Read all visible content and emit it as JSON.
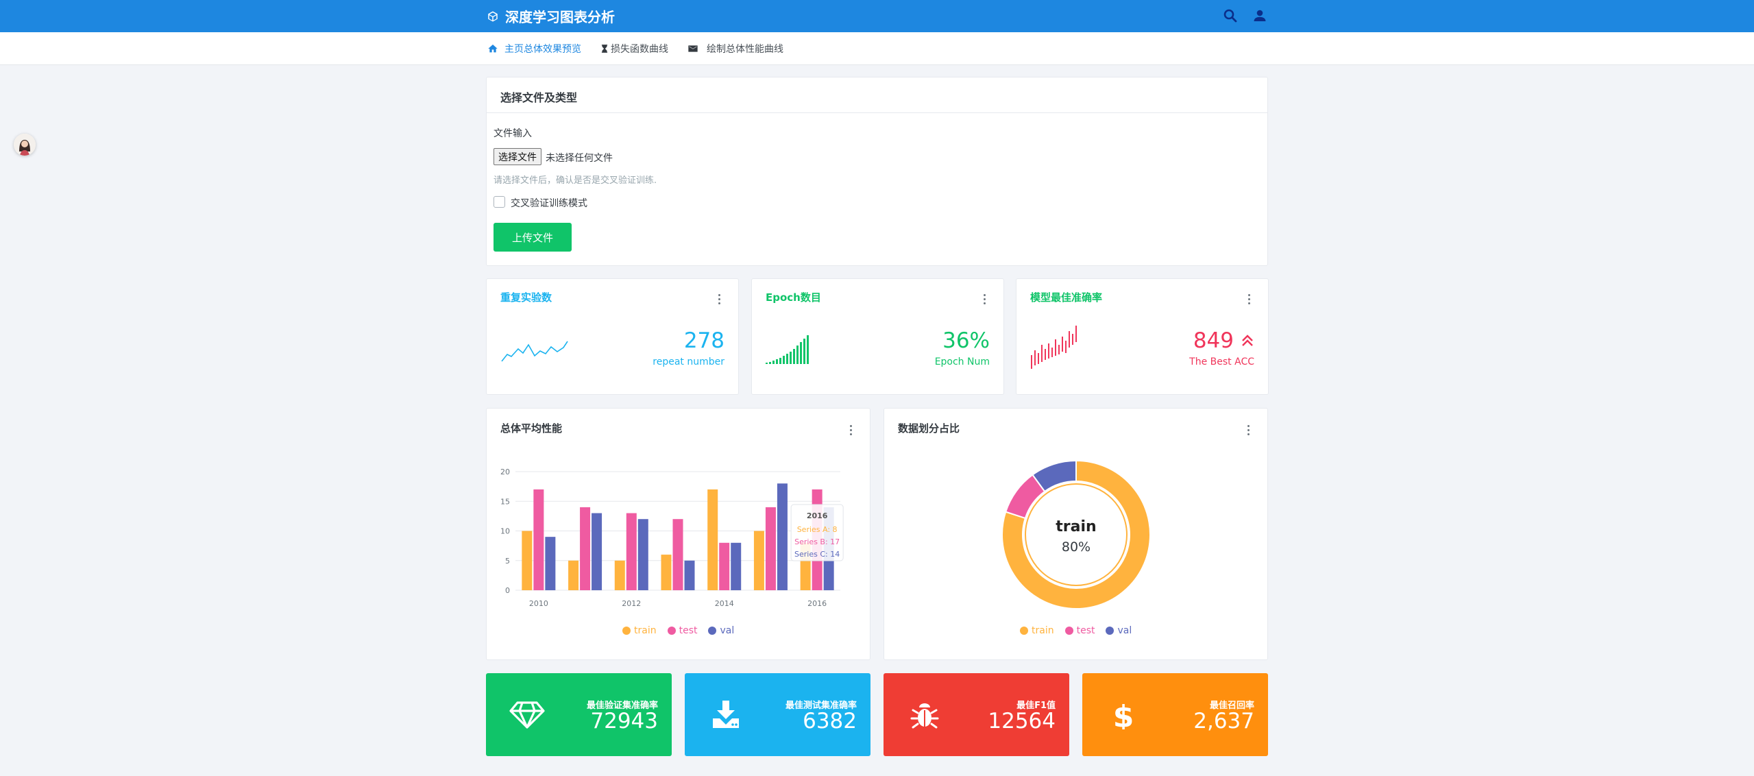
{
  "header": {
    "title": "深度学习图表分析"
  },
  "nav": [
    {
      "label": "主页总体效果预览"
    },
    {
      "label": "损失函数曲线"
    },
    {
      "label": "绘制总体性能曲线"
    }
  ],
  "upload": {
    "title": "选择文件及类型",
    "file_label": "文件输入",
    "choose_button": "选择文件",
    "no_file": "未选择任何文件",
    "help": "请选择文件后，确认是否是交叉验证训练.",
    "checkbox_label": "交叉验证训练模式",
    "upload_button": "上传文件"
  },
  "stats": [
    {
      "title": "重复实验数",
      "value": "278",
      "sub": "repeat number",
      "color": "#1bb3ef"
    },
    {
      "title": "Epoch数目",
      "value": "36%",
      "sub": "Epoch Num",
      "color": "#10c469"
    },
    {
      "title": "模型最佳准确率",
      "value": "849",
      "sub": "The Best ACC",
      "color": "#f0355a"
    }
  ],
  "bar_card": {
    "title": "总体平均性能"
  },
  "donut_card": {
    "title": "数据划分占比"
  },
  "chart_data": [
    {
      "type": "bar",
      "categories": [
        "2010",
        "2011",
        "2012",
        "2013",
        "2014",
        "2015",
        "2016"
      ],
      "x_tick_labels": [
        "2010",
        "2012",
        "2014",
        "2016"
      ],
      "y_ticks": [
        0,
        5,
        10,
        15,
        20
      ],
      "ylim": [
        0,
        20
      ],
      "grid": true,
      "legend_position": "bottom",
      "series": [
        {
          "name": "train",
          "color": "#ffb33e",
          "values": [
            10,
            5,
            5,
            6,
            17,
            10,
            8
          ]
        },
        {
          "name": "test",
          "color": "#ef5ba1",
          "values": [
            17,
            14,
            13,
            12,
            8,
            14,
            17
          ]
        },
        {
          "name": "val",
          "color": "#5b69bc",
          "values": [
            9,
            13,
            12,
            5,
            8,
            18,
            14
          ]
        }
      ],
      "tooltip": {
        "title": "2016",
        "lines": [
          "Series A: 8",
          "Series B: 17",
          "Series C: 14"
        ]
      }
    },
    {
      "type": "pie",
      "variant": "donut",
      "legend_position": "bottom",
      "center_label": "train",
      "center_value": "80%",
      "slices": [
        {
          "name": "train",
          "value": 80,
          "color": "#ffb33e"
        },
        {
          "name": "test",
          "value": 10,
          "color": "#ef5ba1"
        },
        {
          "name": "val",
          "value": 10,
          "color": "#5b69bc"
        }
      ]
    }
  ],
  "tiles": [
    {
      "label": "最佳验证集准确率",
      "value": "72943",
      "color": "#10c469",
      "icon": "diamond-icon"
    },
    {
      "label": "最佳测试集准确率",
      "value": "6382",
      "color": "#1bb3ef",
      "icon": "download-icon"
    },
    {
      "label": "最佳F1值",
      "value": "12564",
      "color": "#ef3d34",
      "icon": "bug-icon"
    },
    {
      "label": "最佳召回率",
      "value": "2,637",
      "color": "#ff8f0e",
      "icon": "dollar-icon"
    }
  ]
}
